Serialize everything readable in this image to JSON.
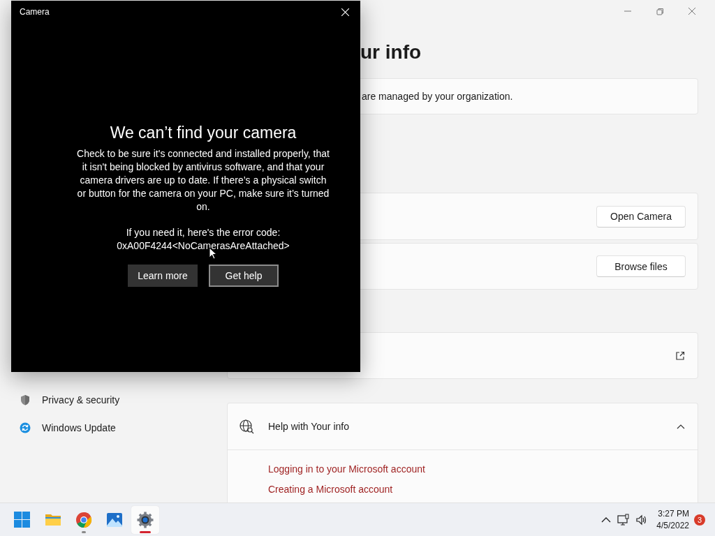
{
  "settings_window": {
    "page_title": "ur info",
    "org_notice": "are managed by your organization.",
    "sidebar": {
      "items": [
        {
          "label": "Privacy & security",
          "kind": "shield"
        },
        {
          "label": "Windows Update",
          "kind": "update"
        }
      ]
    },
    "cards": [
      {
        "kind": "button",
        "button": "Open Camera"
      },
      {
        "kind": "button",
        "button": "Browse files"
      },
      {
        "kind": "external_link"
      }
    ],
    "help": {
      "title": "Help with Your info",
      "expanded": true,
      "links": [
        "Logging in to your Microsoft account",
        "Creating a Microsoft account"
      ]
    }
  },
  "camera_dialog": {
    "title": "Camera",
    "heading": "We can’t find your camera",
    "message": "Check to be sure it's connected and installed properly, that it isn't being blocked by antivirus software, and that your camera drivers are up to date. If there’s a physical switch or button for the camera on your PC, make sure it’s turned on.",
    "error_label": "If you need it, here's the error code:",
    "error_code": "0xA00F4244<NoCamerasAreAttached>",
    "buttons": [
      {
        "label": "Learn more",
        "focused": false
      },
      {
        "label": "Get help",
        "focused": true
      }
    ]
  },
  "taskbar": {
    "apps": [
      {
        "kind": "start",
        "running": false,
        "active": false
      },
      {
        "kind": "folder",
        "running": false,
        "active": false
      },
      {
        "kind": "browser",
        "running": true,
        "active": false
      },
      {
        "kind": "photos",
        "running": false,
        "active": false
      },
      {
        "kind": "settings",
        "running": true,
        "active": true
      }
    ],
    "time": "3:27 PM",
    "date": "4/5/2022",
    "notification_count": "3"
  }
}
